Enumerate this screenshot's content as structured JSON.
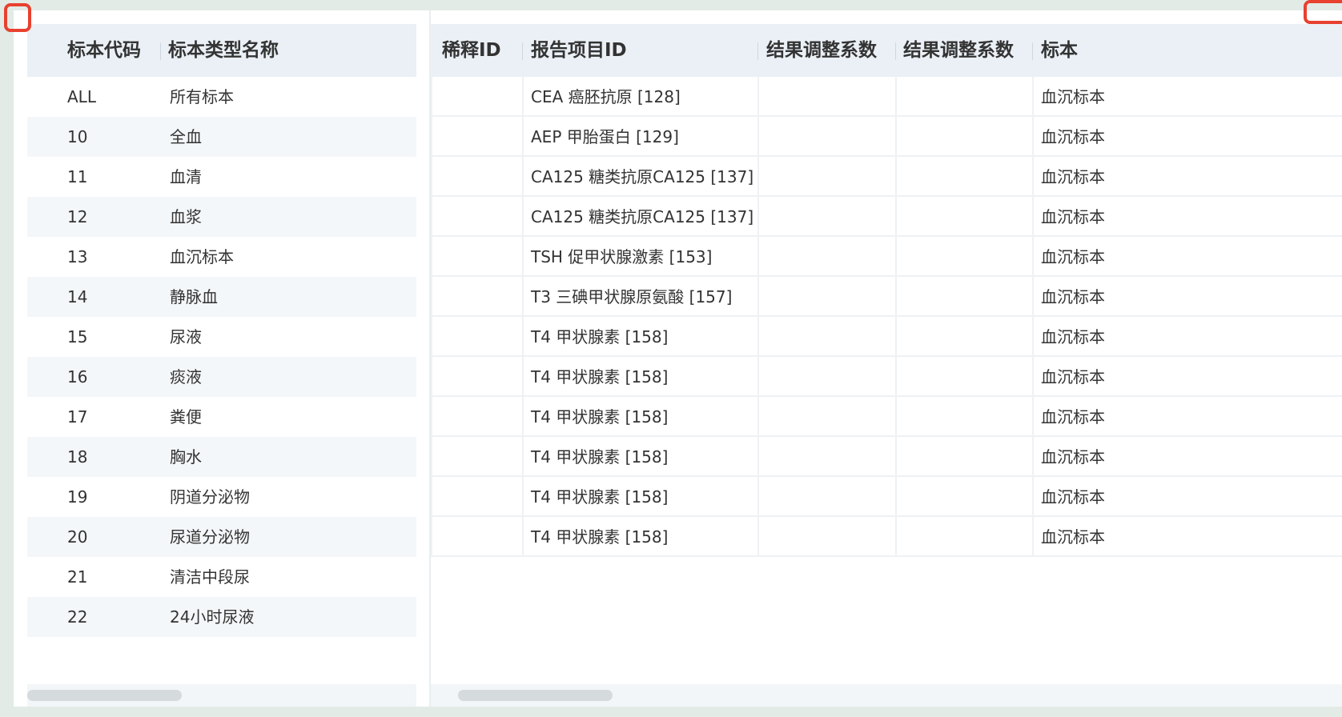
{
  "left_table": {
    "headers": [
      "标本代码",
      "标本类型名称"
    ],
    "rows": [
      {
        "code": "ALL",
        "name": "所有标本"
      },
      {
        "code": "10",
        "name": "全血"
      },
      {
        "code": "11",
        "name": "血清"
      },
      {
        "code": "12",
        "name": "血浆"
      },
      {
        "code": "13",
        "name": "血沉标本"
      },
      {
        "code": "14",
        "name": "静脉血"
      },
      {
        "code": "15",
        "name": "尿液"
      },
      {
        "code": "16",
        "name": "痰液"
      },
      {
        "code": "17",
        "name": "粪便"
      },
      {
        "code": "18",
        "name": "胸水"
      },
      {
        "code": "19",
        "name": "阴道分泌物"
      },
      {
        "code": "20",
        "name": "尿道分泌物"
      },
      {
        "code": "21",
        "name": "清洁中段尿"
      },
      {
        "code": "22",
        "name": "24小时尿液"
      }
    ]
  },
  "right_table": {
    "headers": [
      "稀释ID",
      "报告项目ID",
      "结果调整系数",
      "结果调整系数",
      "标本"
    ],
    "rows": [
      {
        "dilution": "",
        "item": "CEA 癌胚抗原 [128]",
        "coef1": "",
        "coef2": "",
        "specimen": "血沉标本"
      },
      {
        "dilution": "",
        "item": "AEP 甲胎蛋白 [129]",
        "coef1": "",
        "coef2": "",
        "specimen": "血沉标本"
      },
      {
        "dilution": "",
        "item": "CA125 糖类抗原CA125 [137]",
        "coef1": "",
        "coef2": "",
        "specimen": "血沉标本"
      },
      {
        "dilution": "",
        "item": "CA125 糖类抗原CA125 [137]",
        "coef1": "",
        "coef2": "",
        "specimen": "血沉标本"
      },
      {
        "dilution": "",
        "item": "TSH 促甲状腺激素 [153]",
        "coef1": "",
        "coef2": "",
        "specimen": "血沉标本"
      },
      {
        "dilution": "",
        "item": "T3 三碘甲状腺原氨酸 [157]",
        "coef1": "",
        "coef2": "",
        "specimen": "血沉标本"
      },
      {
        "dilution": "",
        "item": "T4 甲状腺素 [158]",
        "coef1": "",
        "coef2": "",
        "specimen": "血沉标本"
      },
      {
        "dilution": "",
        "item": "T4 甲状腺素 [158]",
        "coef1": "",
        "coef2": "",
        "specimen": "血沉标本"
      },
      {
        "dilution": "",
        "item": "T4 甲状腺素 [158]",
        "coef1": "",
        "coef2": "",
        "specimen": "血沉标本"
      },
      {
        "dilution": "",
        "item": "T4 甲状腺素 [158]",
        "coef1": "",
        "coef2": "",
        "specimen": "血沉标本"
      },
      {
        "dilution": "",
        "item": "T4 甲状腺素 [158]",
        "coef1": "",
        "coef2": "",
        "specimen": "血沉标本"
      },
      {
        "dilution": "",
        "item": "T4 甲状腺素 [158]",
        "coef1": "",
        "coef2": "",
        "specimen": "血沉标本"
      }
    ]
  },
  "colors": {
    "header_bg": "#eaf0f5",
    "stripe_bg": "#f4f7f9",
    "marker": "#e8412f",
    "frame_bg": "#e3ebe6"
  }
}
